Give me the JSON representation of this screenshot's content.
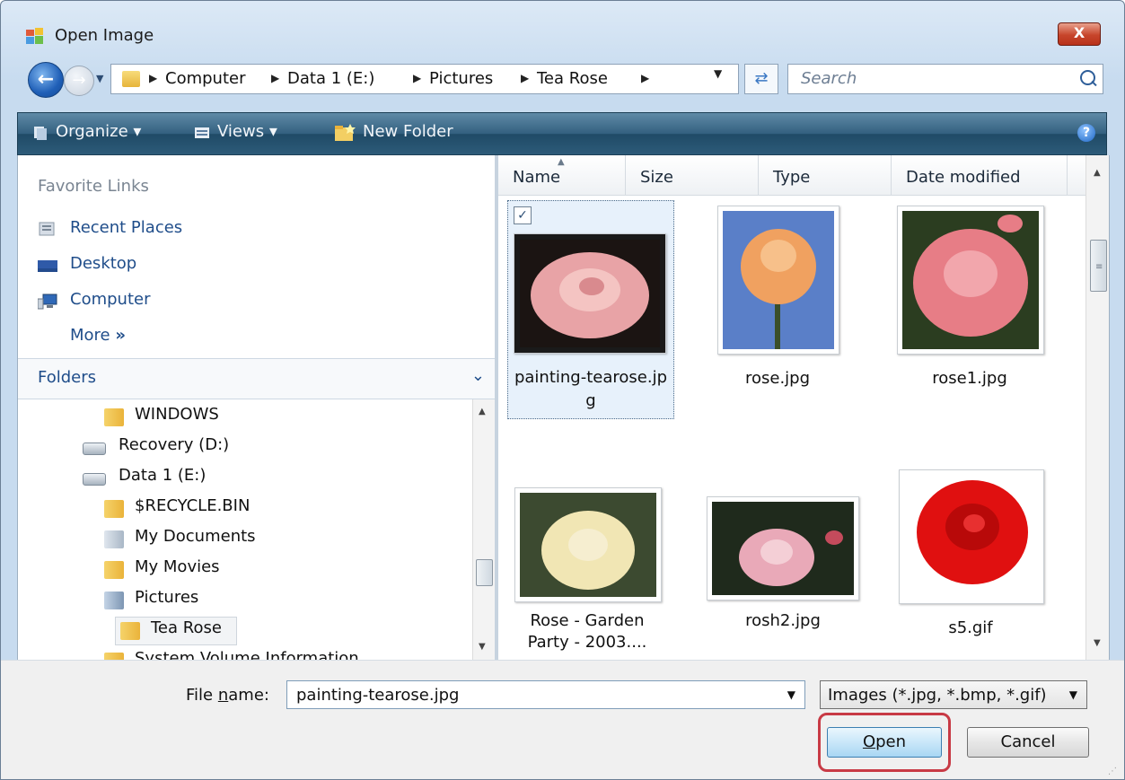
{
  "window": {
    "title": "Open Image",
    "close_label": "X"
  },
  "address": {
    "crumbs": [
      "Computer",
      "Data 1 (E:)",
      "Pictures",
      "Tea Rose"
    ],
    "search_placeholder": "Search"
  },
  "toolbar": {
    "organize": "Organize",
    "views": "Views",
    "new_folder": "New Folder",
    "help": "?"
  },
  "favorites": {
    "heading": "Favorite Links",
    "items": [
      "Recent Places",
      "Desktop",
      "Computer"
    ],
    "more": "More"
  },
  "folders": {
    "title": "Folders",
    "tree": [
      "WINDOWS",
      "Recovery (D:)",
      "Data 1 (E:)",
      "$RECYCLE.BIN",
      "My Documents",
      "My Movies",
      "Pictures",
      "Tea Rose",
      "System Volume Information"
    ]
  },
  "columns": [
    "Name",
    "Size",
    "Type",
    "Date modified"
  ],
  "files": [
    {
      "name_line1": "painting-tearose.jp",
      "name_line2": "g",
      "selected": true,
      "color": "#e8a3a6"
    },
    {
      "name_line1": "rose.jpg",
      "name_line2": "",
      "selected": false,
      "color": "#f0a160"
    },
    {
      "name_line1": "rose1.jpg",
      "name_line2": "",
      "selected": false,
      "color": "#e77d86"
    },
    {
      "name_line1": "Rose - Garden",
      "name_line2": "Party - 2003....",
      "selected": false,
      "color": "#f1e6b4"
    },
    {
      "name_line1": "rosh2.jpg",
      "name_line2": "",
      "selected": false,
      "color": "#e9a9b8"
    },
    {
      "name_line1": "s5.gif",
      "name_line2": "",
      "selected": false,
      "color": "#e01010"
    }
  ],
  "bottom": {
    "file_name_label_prefix": "File ",
    "file_name_label_accel": "n",
    "file_name_label_suffix": "ame:",
    "file_name_value": "painting-tearose.jpg",
    "file_type": "Images (*.jpg, *.bmp, *.gif)",
    "open_accel": "O",
    "open_rest": "pen",
    "cancel": "Cancel"
  }
}
